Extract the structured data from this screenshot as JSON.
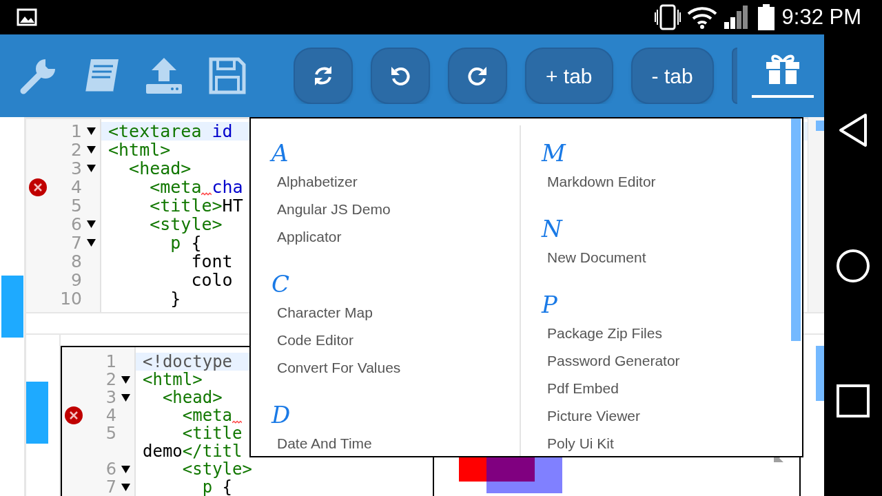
{
  "status_bar": {
    "time": "9:32 PM"
  },
  "toolbar": {
    "tools": [
      {
        "kind": "wrench"
      },
      {
        "kind": "book"
      },
      {
        "kind": "upload"
      },
      {
        "kind": "save"
      }
    ],
    "buttons": [
      {
        "kind": "sync"
      },
      {
        "kind": "undo"
      },
      {
        "kind": "redo"
      },
      {
        "kind": "text",
        "label": "+ tab"
      },
      {
        "kind": "text",
        "label": "- tab"
      },
      {
        "kind": "partial"
      }
    ],
    "gift_tab": {
      "selected": true
    }
  },
  "editor": {
    "lines": [
      {
        "number": "1",
        "fold": true,
        "error": false,
        "active": true,
        "tokens": [
          {
            "kind": "tag",
            "text": "<textarea "
          },
          {
            "kind": "attr",
            "text": "id"
          }
        ]
      },
      {
        "number": "2",
        "fold": true,
        "error": false,
        "active": false,
        "tokens": [
          {
            "kind": "tag",
            "text": "<html>"
          }
        ]
      },
      {
        "number": "3",
        "fold": true,
        "error": false,
        "active": false,
        "tokens": [
          {
            "kind": "tag",
            "text": "  <head>"
          }
        ]
      },
      {
        "number": "4",
        "fold": false,
        "error": true,
        "active": false,
        "tokens": [
          {
            "kind": "tag_warn",
            "text": "    <meta"
          },
          {
            "kind": "attr",
            "text": "cha"
          }
        ]
      },
      {
        "number": "5",
        "fold": false,
        "error": false,
        "active": false,
        "tokens": [
          {
            "kind": "tag",
            "text": "    <title>"
          },
          {
            "kind": "plain",
            "text": "HT"
          }
        ]
      },
      {
        "number": "6",
        "fold": true,
        "error": false,
        "active": false,
        "tokens": [
          {
            "kind": "tag",
            "text": "    <style>"
          }
        ]
      },
      {
        "number": "7",
        "fold": true,
        "error": false,
        "active": false,
        "tokens": [
          {
            "kind": "tag",
            "text": "      p"
          },
          {
            "kind": "plain",
            "text": " {"
          }
        ]
      },
      {
        "number": "8",
        "fold": false,
        "error": false,
        "active": false,
        "tokens": [
          {
            "kind": "plain",
            "text": "        font"
          }
        ]
      },
      {
        "number": "9",
        "fold": false,
        "error": false,
        "active": false,
        "tokens": [
          {
            "kind": "plain",
            "text": "        colo"
          }
        ]
      },
      {
        "number": "10",
        "fold": false,
        "error": false,
        "active": false,
        "tokens": [
          {
            "kind": "plain",
            "text": "      }"
          }
        ]
      }
    ]
  },
  "preview_editor": {
    "lines": [
      {
        "number": "1",
        "fold": false,
        "error": false,
        "active": true,
        "tokens": [
          {
            "kind": "doctype",
            "text": "<!doctype"
          }
        ]
      },
      {
        "number": "2",
        "fold": true,
        "error": false,
        "active": false,
        "tokens": [
          {
            "kind": "tag",
            "text": "<html>"
          }
        ]
      },
      {
        "number": "3",
        "fold": true,
        "error": false,
        "active": false,
        "tokens": [
          {
            "kind": "tag",
            "text": "  <head>"
          }
        ]
      },
      {
        "number": "4",
        "fold": false,
        "error": true,
        "active": false,
        "tokens": [
          {
            "kind": "tag_warn",
            "text": "    <meta"
          }
        ]
      },
      {
        "number": "5",
        "fold": false,
        "error": false,
        "active": false,
        "tokens": [
          {
            "kind": "tag",
            "text": "    <title"
          }
        ]
      },
      {
        "fold": false,
        "error": false,
        "active": false,
        "tokens": [
          {
            "kind": "plain",
            "text": "demo"
          },
          {
            "kind": "tag",
            "text": "</titl"
          }
        ]
      },
      {
        "number": "6",
        "fold": true,
        "error": false,
        "active": false,
        "tokens": [
          {
            "kind": "tag",
            "text": "    <style>"
          }
        ]
      },
      {
        "number": "7",
        "fold": true,
        "error": false,
        "active": false,
        "tokens": [
          {
            "kind": "tag",
            "text": "      p"
          },
          {
            "kind": "plain",
            "text": " {"
          }
        ]
      }
    ]
  },
  "menu": {
    "columns": [
      {
        "groups": [
          {
            "letter": "A",
            "items": [
              "Alphabetizer",
              "Angular JS Demo",
              "Applicator"
            ]
          },
          {
            "letter": "C",
            "items": [
              "Character Map",
              "Code Editor",
              "Convert For Values"
            ]
          },
          {
            "letter": "D",
            "items": [
              "Date And Time"
            ]
          }
        ]
      },
      {
        "groups": [
          {
            "letter": "M",
            "items": [
              "Markdown Editor"
            ]
          },
          {
            "letter": "N",
            "items": [
              "New Document"
            ]
          },
          {
            "letter": "P",
            "items": [
              "Package Zip Files",
              "Password Generator",
              "Pdf Embed",
              "Picture Viewer",
              "Poly Ui Kit"
            ]
          }
        ]
      }
    ]
  }
}
